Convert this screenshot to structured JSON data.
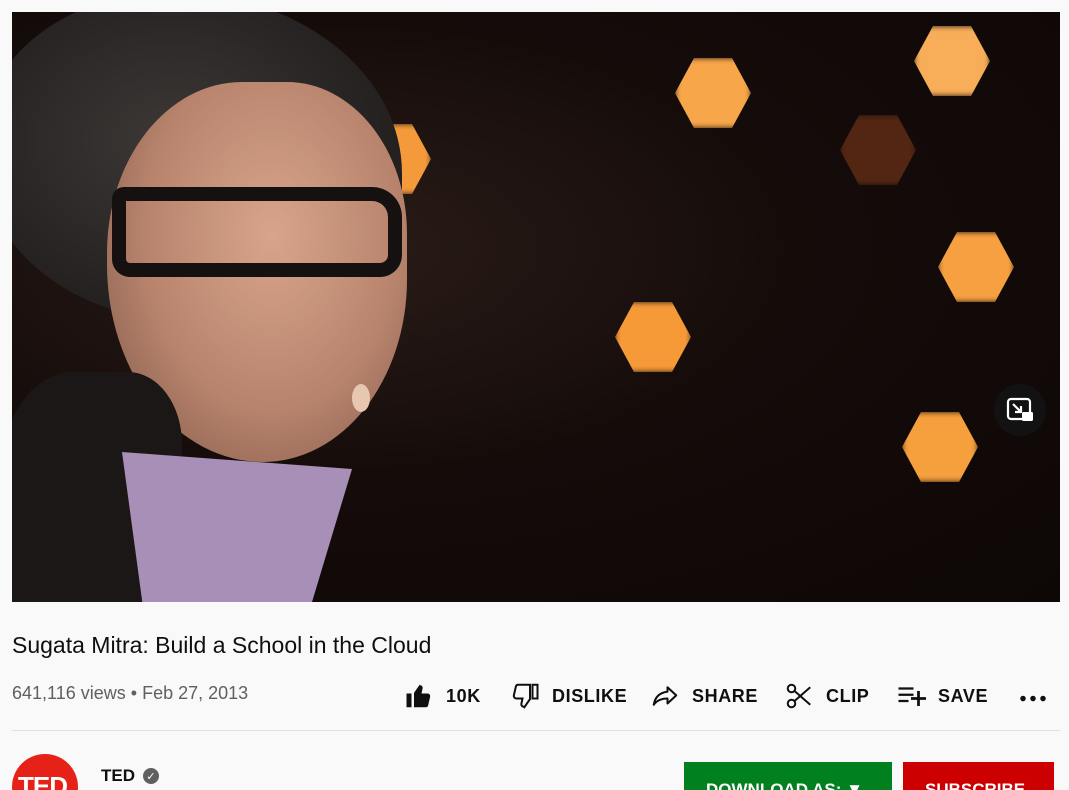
{
  "video": {
    "title": "Sugata Mitra: Build a School in the Cloud",
    "views": "641,116 views",
    "separator": "•",
    "date": "Feb 27, 2013"
  },
  "actions": {
    "like_count": "10K",
    "dislike_label": "DISLIKE",
    "share_label": "SHARE",
    "clip_label": "CLIP",
    "save_label": "SAVE"
  },
  "channel": {
    "name": "TED",
    "avatar_text": "TED",
    "verified_mark": "✓"
  },
  "buttons": {
    "download_label": "DOWNLOAD AS: ▼",
    "subscribe_label": "SUBSCRIBE"
  },
  "icons": [
    "like-icon",
    "dislike-icon",
    "share-icon",
    "clip-icon",
    "save-icon",
    "more-icon",
    "miniplayer-icon",
    "verified-icon"
  ],
  "colors": {
    "download": "#00801f",
    "subscribe": "#cc0000",
    "avatar": "#e62117",
    "meta_text": "#606060"
  }
}
